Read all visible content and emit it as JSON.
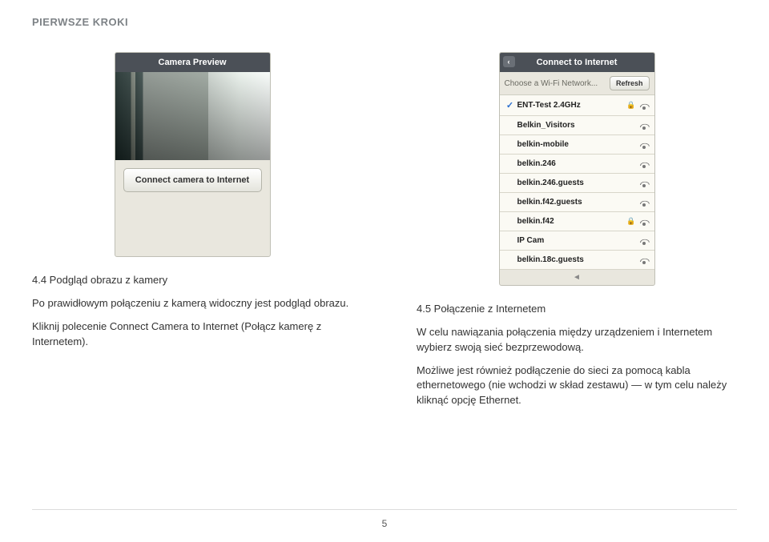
{
  "header": "PIERWSZE KROKI",
  "left": {
    "phone": {
      "title": "Camera Preview",
      "button": "Connect camera to Internet"
    },
    "section_title": "4.4 Podgląd obrazu z kamery",
    "p1": "Po prawidłowym połączeniu z kamerą widoczny jest podgląd obrazu.",
    "p2": "Kliknij polecenie Connect Camera to Internet (Połącz kamerę z Internetem)."
  },
  "right": {
    "phone": {
      "title": "Connect to Internet",
      "choose_label": "Choose a Wi-Fi Network...",
      "refresh": "Refresh",
      "networks": [
        {
          "name": "ENT-Test 2.4GHz",
          "selected": true,
          "locked": true
        },
        {
          "name": "Belkin_Visitors",
          "selected": false,
          "locked": false
        },
        {
          "name": "belkin-mobile",
          "selected": false,
          "locked": false
        },
        {
          "name": "belkin.246",
          "selected": false,
          "locked": false
        },
        {
          "name": "belkin.246.guests",
          "selected": false,
          "locked": false
        },
        {
          "name": "belkin.f42.guests",
          "selected": false,
          "locked": false
        },
        {
          "name": "belkin.f42",
          "selected": false,
          "locked": true
        },
        {
          "name": "IP Cam",
          "selected": false,
          "locked": false
        },
        {
          "name": "belkin.18c.guests",
          "selected": false,
          "locked": false
        }
      ]
    },
    "section_title": "4.5 Połączenie z Internetem",
    "p1": "W celu nawiązania połączenia między urządzeniem i Internetem wybierz swoją sieć bezprzewodową.",
    "p2": "Możliwe jest również podłączenie do sieci za pomocą kabla ethernetowego (nie wchodzi w skład zestawu) — w tym celu należy kliknąć opcję Ethernet."
  },
  "page_number": "5"
}
